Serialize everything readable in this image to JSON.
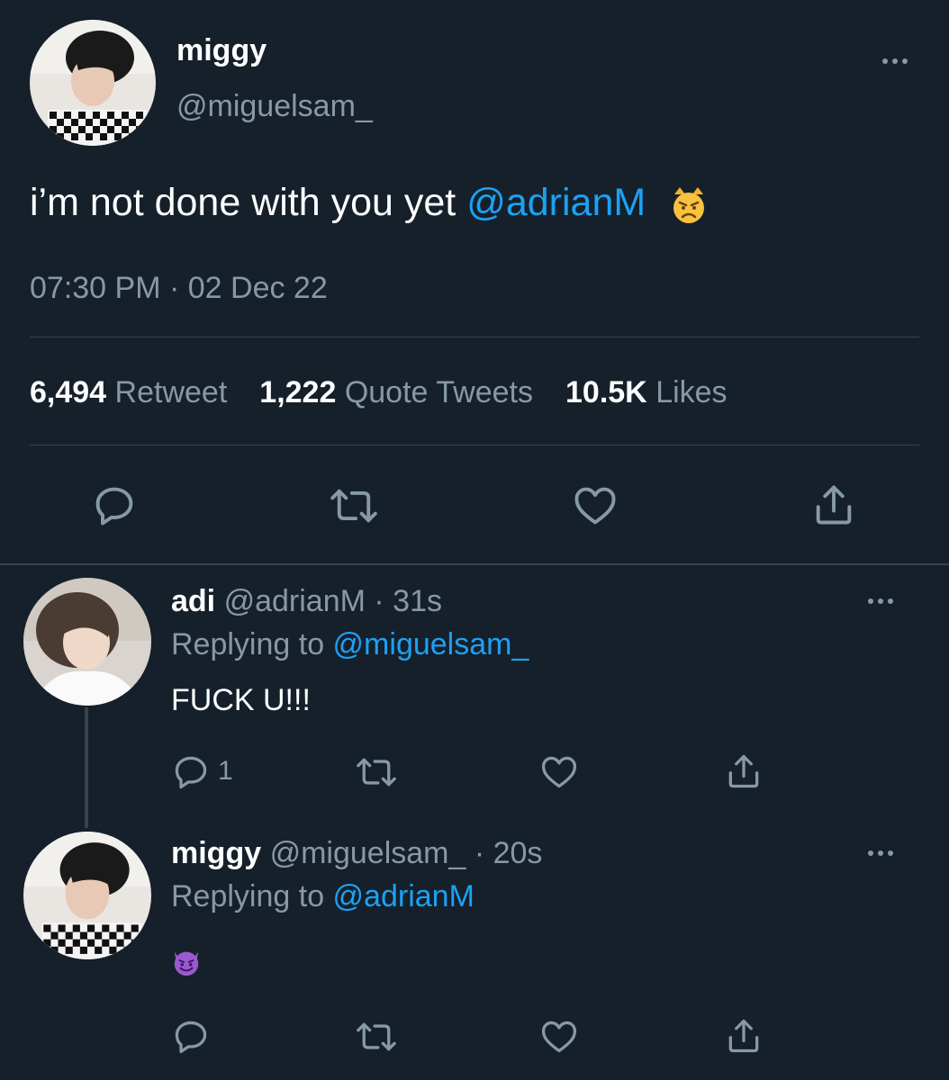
{
  "main_tweet": {
    "name": "miggy",
    "handle": "@miguelsam_",
    "text_prefix": "i’m not done with you yet ",
    "mention": "@adrianM",
    "emoji": "cat-pouting-emoji",
    "timestamp": "07:30 PM · 02 Dec 22",
    "stats": {
      "retweets_value": "6,494",
      "retweets_label": "Retweet",
      "quotes_value": "1,222",
      "quotes_label": "Quote Tweets",
      "likes_value": "10.5K",
      "likes_label": "Likes"
    }
  },
  "replies": [
    {
      "name": "adi",
      "handle": "@adrianM",
      "time": "· 31s",
      "replying_label": "Replying to ",
      "replying_to": "@miguelsam_",
      "text": "FUCK U!!!",
      "reply_count": "1"
    },
    {
      "name": "miggy",
      "handle": "@miguelsam_",
      "time": "· 20s",
      "replying_label": "Replying to ",
      "replying_to": "@adrianM",
      "emoji": "smiling-devil-emoji"
    }
  ],
  "colors": {
    "background": "#15202b",
    "text": "#ffffff",
    "muted": "#8899a6",
    "link": "#1da1f2",
    "divider": "#38444d"
  }
}
